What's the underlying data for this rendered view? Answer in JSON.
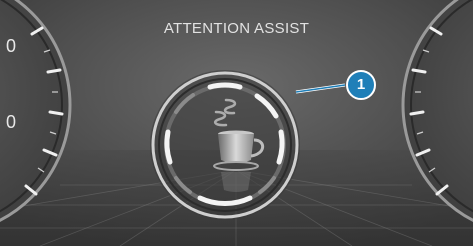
{
  "screen": {
    "title": "ATTENTION ASSIST"
  },
  "center_gauge": {
    "icon": "coffee-cup-icon"
  },
  "callout": {
    "label": "1"
  },
  "left_gauge": {
    "visible_digits": [
      "0",
      "0"
    ]
  },
  "colors": {
    "background": "#4a4a4a",
    "text": "#e2e2e2",
    "callout": "#1f7fb8",
    "segment_active": "#f4f4f4"
  }
}
